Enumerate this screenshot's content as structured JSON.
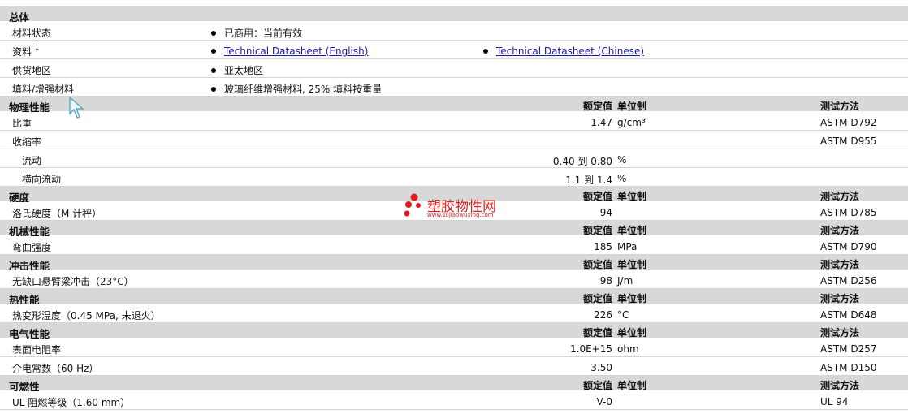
{
  "general": {
    "title": "总体",
    "rows": [
      {
        "label": "材料状态",
        "bullets": [
          "已商用：当前有效"
        ]
      },
      {
        "label": "资料",
        "sup": "1",
        "links": [
          "Technical Datasheet (English)",
          "Technical Datasheet (Chinese)"
        ]
      },
      {
        "label": "供货地区",
        "bullets": [
          "亚太地区"
        ]
      },
      {
        "label": "填料/增强材料",
        "bullets": [
          "玻璃纤维增强材料, 25% 填料按重量"
        ]
      }
    ]
  },
  "columns": {
    "value": "额定值",
    "unit": "单位制",
    "test": "测试方法"
  },
  "sections": {
    "physical": {
      "title": "物理性能",
      "rows": [
        {
          "name": "比重",
          "value": "1.47",
          "unit": "g/cm³",
          "test": "ASTM D792"
        },
        {
          "name": "收缩率",
          "value": "",
          "unit": "",
          "test": "ASTM D955"
        },
        {
          "name": "流动",
          "value": "0.40 到  0.80",
          "unit": "%",
          "test": ""
        },
        {
          "name": "横向流动",
          "value": "1.1 到  1.4",
          "unit": "%",
          "test": ""
        }
      ]
    },
    "hardness": {
      "title": "硬度",
      "rows": [
        {
          "name": "洛氏硬度（M 计秤）",
          "value": "94",
          "unit": "",
          "test": "ASTM D785"
        }
      ]
    },
    "mechanical": {
      "title": "机械性能",
      "rows": [
        {
          "name": "弯曲强度",
          "value": "185",
          "unit": "MPa",
          "test": "ASTM D790"
        }
      ]
    },
    "impact": {
      "title": "冲击性能",
      "rows": [
        {
          "name": "无缺口悬臂梁冲击（23°C）",
          "value": "98",
          "unit": "J/m",
          "test": "ASTM D256"
        }
      ]
    },
    "thermal": {
      "title": "热性能",
      "rows": [
        {
          "name": "热变形温度（0.45 MPa, 未退火）",
          "value": "226",
          "unit": "°C",
          "test": "ASTM D648"
        }
      ]
    },
    "electrical": {
      "title": "电气性能",
      "rows": [
        {
          "name": "表面电阻率",
          "value": "1.0E+15",
          "unit": "ohm",
          "test": "ASTM D257"
        },
        {
          "name": "介电常数（60 Hz）",
          "value": "3.50",
          "unit": "",
          "test": "ASTM D150"
        }
      ]
    },
    "flammability": {
      "title": "可燃性",
      "rows": [
        {
          "name": "UL 阻燃等级（1.60 mm）",
          "value": "V-0",
          "unit": "",
          "test": "UL 94"
        }
      ]
    }
  },
  "watermark": {
    "name": "塑胶物性网",
    "url": "www.sujiaowuxing.com",
    "color": "#e02020"
  }
}
